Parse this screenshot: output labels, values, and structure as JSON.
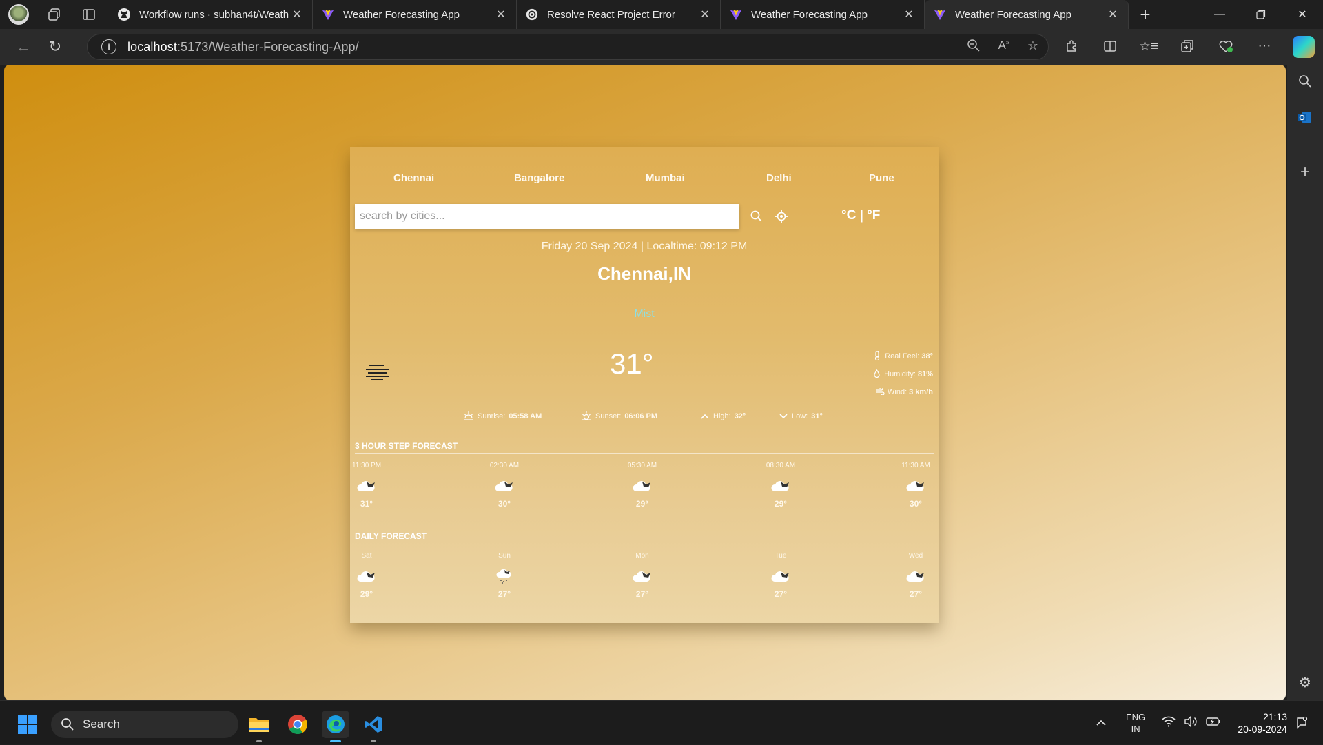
{
  "browser": {
    "tabs": [
      {
        "title": "Workflow runs · subhan4t/Weath",
        "favicon": "github-icon",
        "active": false
      },
      {
        "title": "Weather Forecasting App",
        "favicon": "vite-icon",
        "active": false
      },
      {
        "title": "Resolve React Project Error",
        "favicon": "chatgpt-icon",
        "active": false
      },
      {
        "title": "Weather Forecasting App",
        "favicon": "vite-icon",
        "active": false
      },
      {
        "title": "Weather Forecasting App",
        "favicon": "vite-icon",
        "active": true
      }
    ],
    "url_host": "localhost",
    "url_rest": ":5173/Weather-Forecasting-App/"
  },
  "app": {
    "cities": [
      "Chennai",
      "Bangalore",
      "Mumbai",
      "Delhi",
      "Pune"
    ],
    "search_placeholder": "search by cities...",
    "units_label": "°C | °F",
    "datetime": "Friday 20 Sep 2024 | Localtime: 09:12 PM",
    "location": "Chennai,IN",
    "condition": "Mist",
    "temperature": "31°",
    "details": [
      {
        "icon": "thermometer-icon",
        "label": "Real Feel:",
        "value": "38°"
      },
      {
        "icon": "droplet-icon",
        "label": "Humidity:",
        "value": "81%"
      },
      {
        "icon": "wind-icon",
        "label": "Wind:",
        "value": "3 km/h"
      }
    ],
    "sun_row": [
      {
        "icon": "sunrise-icon",
        "label": "Sunrise:",
        "value": "05:58 AM"
      },
      {
        "icon": "sunset-icon",
        "label": "Sunset:",
        "value": "06:06 PM"
      },
      {
        "icon": "arrow-up-icon",
        "label": "High:",
        "value": "32°"
      },
      {
        "icon": "arrow-down-icon",
        "label": "Low:",
        "value": "31°"
      }
    ],
    "hourly_title": "3 HOUR STEP FORECAST",
    "hourly": [
      {
        "time": "11:30 PM",
        "temp": "31°",
        "icon": "night-cloud-icon"
      },
      {
        "time": "02:30 AM",
        "temp": "30°",
        "icon": "night-cloud-icon"
      },
      {
        "time": "05:30 AM",
        "temp": "29°",
        "icon": "night-cloud-icon"
      },
      {
        "time": "08:30 AM",
        "temp": "29°",
        "icon": "night-cloud-icon"
      },
      {
        "time": "11:30 AM",
        "temp": "30°",
        "icon": "night-cloud-icon"
      }
    ],
    "daily_title": "DAILY FORECAST",
    "daily": [
      {
        "day": "Sat",
        "temp": "29°",
        "icon": "night-cloud-icon"
      },
      {
        "day": "Sun",
        "temp": "27°",
        "icon": "rain-cloud-icon"
      },
      {
        "day": "Mon",
        "temp": "27°",
        "icon": "night-cloud-icon"
      },
      {
        "day": "Tue",
        "temp": "27°",
        "icon": "night-cloud-icon"
      },
      {
        "day": "Wed",
        "temp": "27°",
        "icon": "night-cloud-icon"
      }
    ]
  },
  "taskbar": {
    "search_label": "Search",
    "lang_top": "ENG",
    "lang_bottom": "IN",
    "time": "21:13",
    "date": "20-09-2024"
  },
  "colors": {
    "accent": "#4cc2ff",
    "bg_top": "#cf8e0f",
    "bg_bottom": "#f7eedd",
    "condition": "#8fdfe0"
  }
}
